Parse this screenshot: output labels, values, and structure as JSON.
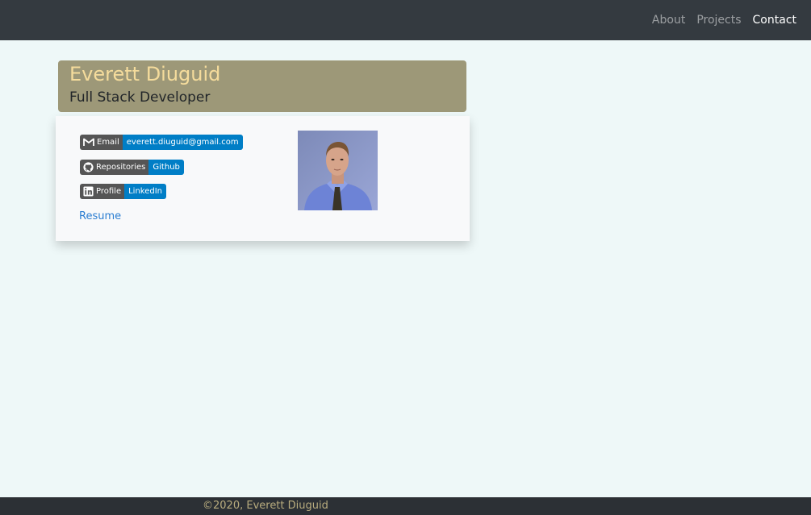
{
  "nav": {
    "links": [
      {
        "label": "About",
        "active": false
      },
      {
        "label": "Projects",
        "active": false
      },
      {
        "label": "Contact",
        "active": true
      }
    ]
  },
  "header": {
    "name": "Everett Diuguid",
    "role": "Full Stack Developer"
  },
  "contact": {
    "badges": [
      {
        "icon": "gmail-icon",
        "label": "Email",
        "value": "everett.diuguid@gmail.com"
      },
      {
        "icon": "github-icon",
        "label": "Repositories",
        "value": "Github"
      },
      {
        "icon": "linkedin-icon",
        "label": "Profile",
        "value": "LinkedIn"
      }
    ],
    "resume_label": "Resume"
  },
  "footer": {
    "text": "©2020, Everett Diuguid"
  },
  "colors": {
    "navbar": "#343a40",
    "page_background": "#eef8f8",
    "header_card": "#9d9878",
    "name_text": "#f5dc9c",
    "badge_label": "#555555",
    "badge_value": "#007ec6",
    "link": "#2a7dd1",
    "footer": "#2c3035",
    "footer_text": "#b9ac7e"
  }
}
